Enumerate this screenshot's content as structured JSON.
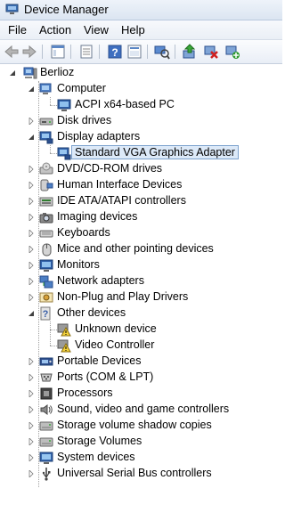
{
  "window": {
    "title": "Device Manager"
  },
  "menu": [
    "File",
    "Action",
    "View",
    "Help"
  ],
  "toolbar": [
    "back",
    "forward",
    "show-hide-console",
    "properties",
    "help",
    "scan-hardware",
    "update-driver",
    "disable-device",
    "enable-device"
  ],
  "tree": {
    "root": "Berlioz",
    "rows": [
      {
        "label": "Computer",
        "level": 1,
        "expanded": true,
        "icon": "computer-icon"
      },
      {
        "label": "ACPI x64-based PC",
        "level": 2,
        "icon": "monitor-icon"
      },
      {
        "label": "Disk drives",
        "level": 1,
        "expanded": false,
        "icon": "disk-icon"
      },
      {
        "label": "Display adapters",
        "level": 1,
        "expanded": true,
        "icon": "display-adapter-icon"
      },
      {
        "label": "Standard VGA Graphics Adapter",
        "level": 2,
        "selected": true,
        "icon": "display-adapter-icon"
      },
      {
        "label": "DVD/CD-ROM drives",
        "level": 1,
        "expanded": false,
        "icon": "dvd-icon"
      },
      {
        "label": "Human Interface Devices",
        "level": 1,
        "expanded": false,
        "icon": "hid-icon"
      },
      {
        "label": "IDE ATA/ATAPI controllers",
        "level": 1,
        "expanded": false,
        "icon": "ide-icon"
      },
      {
        "label": "Imaging devices",
        "level": 1,
        "expanded": false,
        "icon": "camera-icon"
      },
      {
        "label": "Keyboards",
        "level": 1,
        "expanded": false,
        "icon": "keyboard-icon"
      },
      {
        "label": "Mice and other pointing devices",
        "level": 1,
        "expanded": false,
        "icon": "mouse-icon"
      },
      {
        "label": "Monitors",
        "level": 1,
        "expanded": false,
        "icon": "monitor-icon"
      },
      {
        "label": "Network adapters",
        "level": 1,
        "expanded": false,
        "icon": "network-icon"
      },
      {
        "label": "Non-Plug and Play Drivers",
        "level": 1,
        "expanded": false,
        "icon": "driver-icon"
      },
      {
        "label": "Other devices",
        "level": 1,
        "expanded": true,
        "icon": "other-devices-icon"
      },
      {
        "label": "Unknown device",
        "level": 2,
        "icon": "warning-icon"
      },
      {
        "label": "Video Controller",
        "level": 2,
        "icon": "warning-icon"
      },
      {
        "label": "Portable Devices",
        "level": 1,
        "expanded": false,
        "icon": "portable-icon"
      },
      {
        "label": "Ports (COM & LPT)",
        "level": 1,
        "expanded": false,
        "icon": "port-icon"
      },
      {
        "label": "Processors",
        "level": 1,
        "expanded": false,
        "icon": "cpu-icon"
      },
      {
        "label": "Sound, video and game controllers",
        "level": 1,
        "expanded": false,
        "icon": "sound-icon"
      },
      {
        "label": "Storage volume shadow copies",
        "level": 1,
        "expanded": false,
        "icon": "storage-icon"
      },
      {
        "label": "Storage Volumes",
        "level": 1,
        "expanded": false,
        "icon": "storage-icon"
      },
      {
        "label": "System devices",
        "level": 1,
        "expanded": false,
        "icon": "system-icon"
      },
      {
        "label": "Universal Serial Bus controllers",
        "level": 1,
        "expanded": false,
        "icon": "usb-icon"
      }
    ]
  }
}
